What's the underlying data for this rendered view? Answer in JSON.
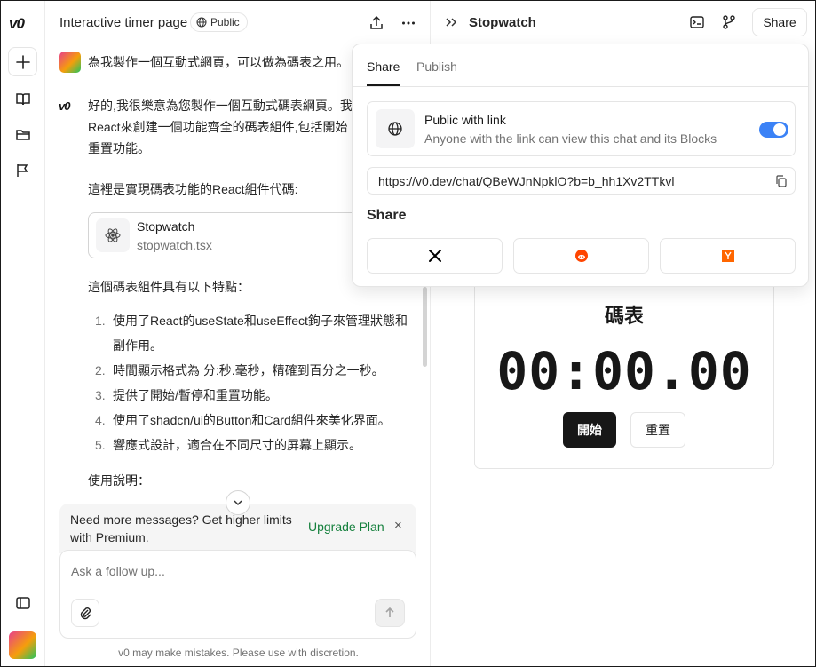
{
  "app": {
    "logo": "v0"
  },
  "chat": {
    "title": "Interactive timer page",
    "visibility": "Public",
    "user_message": "為我製作一個互動式網頁，可以做為碼表之用。",
    "bot_logo": "v0",
    "bot_intro": "好的,我很樂意為您製作一個互動式碼表網頁。我 React來創建一個功能齊全的碼表組件,包括開始 重置功能。",
    "code_intro": "這裡是實現碼表功能的React組件代碼:",
    "file": {
      "name": "Stopwatch",
      "path": "stopwatch.tsx"
    },
    "features_title": "這個碼表組件具有以下特點：",
    "features": [
      {
        "num": "1.",
        "text": "使用了React的useState和useEffect鉤子來管理狀態和副作用。"
      },
      {
        "num": "2.",
        "text": "時間顯示格式為 分:秒.毫秒，精確到百分之一秒。"
      },
      {
        "num": "3.",
        "text": "提供了開始/暫停和重置功能。"
      },
      {
        "num": "4.",
        "text": "使用了shadcn/ui的Button和Card組件來美化界面。"
      },
      {
        "num": "5.",
        "text": "響應式設計，適合在不同尺寸的屏幕上顯示。"
      }
    ],
    "usage_title": "使用說明：",
    "upgrade_text": "Need more messages? Get higher limits with Premium.",
    "upgrade_link": "Upgrade Plan",
    "upgrade_close": "×",
    "composer_placeholder": "Ask a follow up...",
    "disclaimer": "v0 may make mistakes. Please use with discretion."
  },
  "preview": {
    "title": "Stopwatch",
    "share_label": "Share",
    "stopwatch": {
      "title": "碼表",
      "time": "00:00.00",
      "start": "開始",
      "reset": "重置"
    }
  },
  "share_popover": {
    "tabs": [
      "Share",
      "Publish"
    ],
    "public_title": "Public with link",
    "public_sub": "Anyone with the link can view this chat and its Blocks",
    "url": "https://v0.dev/chat/QBeWJnNpklO?b=b_hh1Xv2TTkvl",
    "share_heading": "Share",
    "targets": [
      {
        "icon": "x-icon",
        "color": "#000000"
      },
      {
        "icon": "reddit-icon",
        "color": "#ff4500"
      },
      {
        "icon": "hackernews-icon",
        "color": "#ff6600"
      }
    ],
    "toggle_on": true,
    "toggle_color": "#3b82f6"
  }
}
